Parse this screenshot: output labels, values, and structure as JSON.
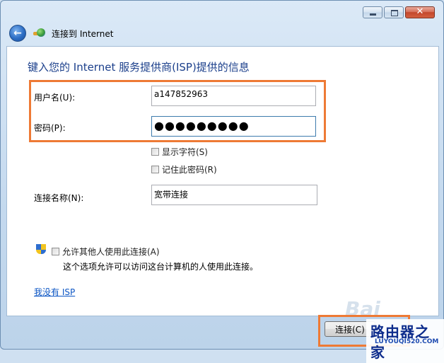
{
  "titlebar": {
    "minimize": "minimize",
    "maximize": "maximize",
    "close": "✕"
  },
  "nav": {
    "back_icon": "arrow-left-icon",
    "app_icon": "network-connection-icon",
    "title": "连接到 Internet"
  },
  "form": {
    "heading": "键入您的 Internet 服务提供商(ISP)提供的信息",
    "username_label": "用户名(U):",
    "username_value": "a147852963",
    "password_label": "密码(P):",
    "password_value": "●●●●●●●●●",
    "show_chars_label": "显示字符(S)",
    "show_chars_checked": false,
    "remember_label": "记住此密码(R)",
    "remember_checked": false,
    "conn_name_label": "连接名称(N):",
    "conn_name_value": "宽带连接",
    "allow_others_label": "允许其他人使用此连接(A)",
    "allow_others_checked": false,
    "allow_others_desc": "这个选项允许可以访问这台计算机的人使用此连接。",
    "no_isp_link": "我没有 ISP"
  },
  "footer": {
    "connect_button": "连接(C)"
  },
  "watermark": {
    "baidu": "Bai",
    "brand": "路由器之家",
    "site": "LUYOUQI520.COM"
  },
  "colors": {
    "highlight": "#ee7a35",
    "heading": "#1b3f8b",
    "link": "#0b55c4"
  }
}
